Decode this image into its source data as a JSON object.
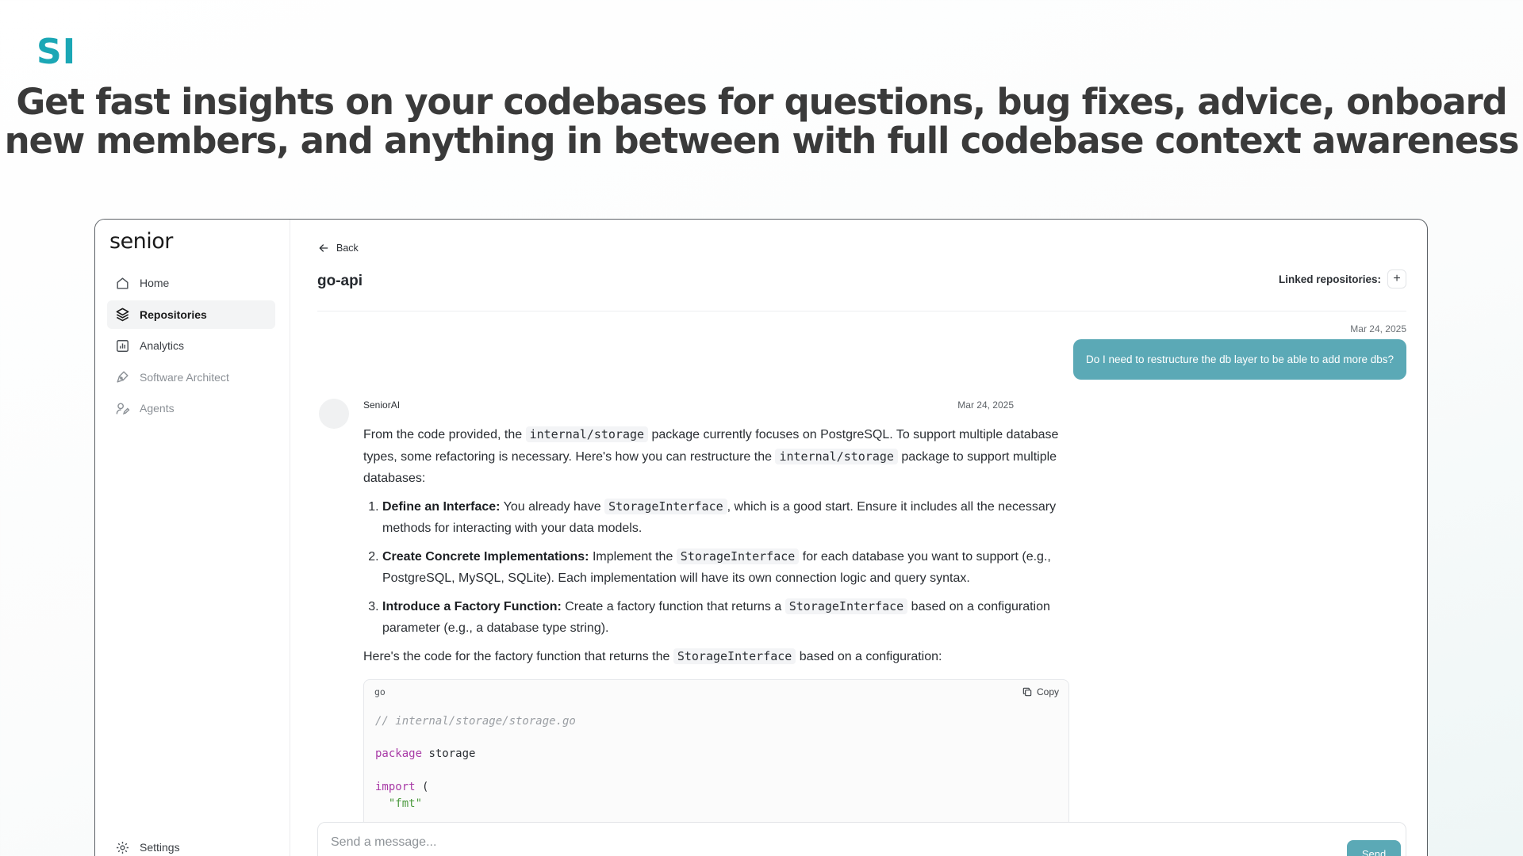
{
  "brand": {
    "logo_text": "SI",
    "accent_color": "#1ba7b5"
  },
  "headline": {
    "line1": "Get fast insights on your codebases for questions, bug fixes, advice, onboard",
    "line2": "new members, and anything in between with full codebase context awareness"
  },
  "app": {
    "logo_text": "senior",
    "sidebar": {
      "items": [
        {
          "label": "Home",
          "icon": "home-icon",
          "state": "normal"
        },
        {
          "label": "Repositories",
          "icon": "layers-icon",
          "state": "active"
        },
        {
          "label": "Analytics",
          "icon": "bar-chart-icon",
          "state": "normal"
        },
        {
          "label": "Software Architect",
          "icon": "pen-tool-icon",
          "state": "muted"
        },
        {
          "label": "Agents",
          "icon": "user-edit-icon",
          "state": "muted"
        }
      ],
      "settings_label": "Settings"
    },
    "header": {
      "back_label": "Back",
      "title": "go-api",
      "linked_repositories_label": "Linked repositories:",
      "add_repo_symbol": "+"
    },
    "chat": {
      "user_message": {
        "date": "Mar 24, 2025",
        "text": "Do I need to restructure the db layer to be able to add more dbs?",
        "bubble_color": "#5ba9b6"
      },
      "ai_message": {
        "name": "SeniorAI",
        "date": "Mar 24, 2025",
        "p1_a": "From the code provided, the ",
        "p1_code1": "internal/storage",
        "p1_b": " package currently focuses on PostgreSQL. To support multiple database types, some refactoring is necessary. Here's how you can restructure the ",
        "p1_code2": "internal/storage",
        "p1_c": " package to support multiple databases:",
        "steps": [
          {
            "title": "Define an Interface:",
            "a": " You already have ",
            "code": "StorageInterface",
            "b": ", which is a good start. Ensure it includes all the necessary methods for interacting with your data models."
          },
          {
            "title": "Create Concrete Implementations:",
            "a": " Implement the ",
            "code": "StorageInterface",
            "b": " for each database you want to support (e.g., PostgreSQL, MySQL, SQLite). Each implementation will have its own connection logic and query syntax."
          },
          {
            "title": "Introduce a Factory Function:",
            "a": " Create a factory function that returns a ",
            "code": "StorageInterface",
            "b": " based on a configuration parameter (e.g., a database type string)."
          }
        ],
        "p2_a": "Here's the code for the factory function that returns the ",
        "p2_code": "StorageInterface",
        "p2_b": " based on a configuration:",
        "code_block": {
          "language": "go",
          "copy_label": "Copy",
          "comment": "// internal/storage/storage.go",
          "package_kw": "package",
          "package_name": " storage",
          "import_kw": "import",
          "import_paren": " (",
          "import_str": "\"fmt\""
        }
      }
    },
    "composer": {
      "placeholder": "Send a message...",
      "send_label": "Send"
    }
  }
}
